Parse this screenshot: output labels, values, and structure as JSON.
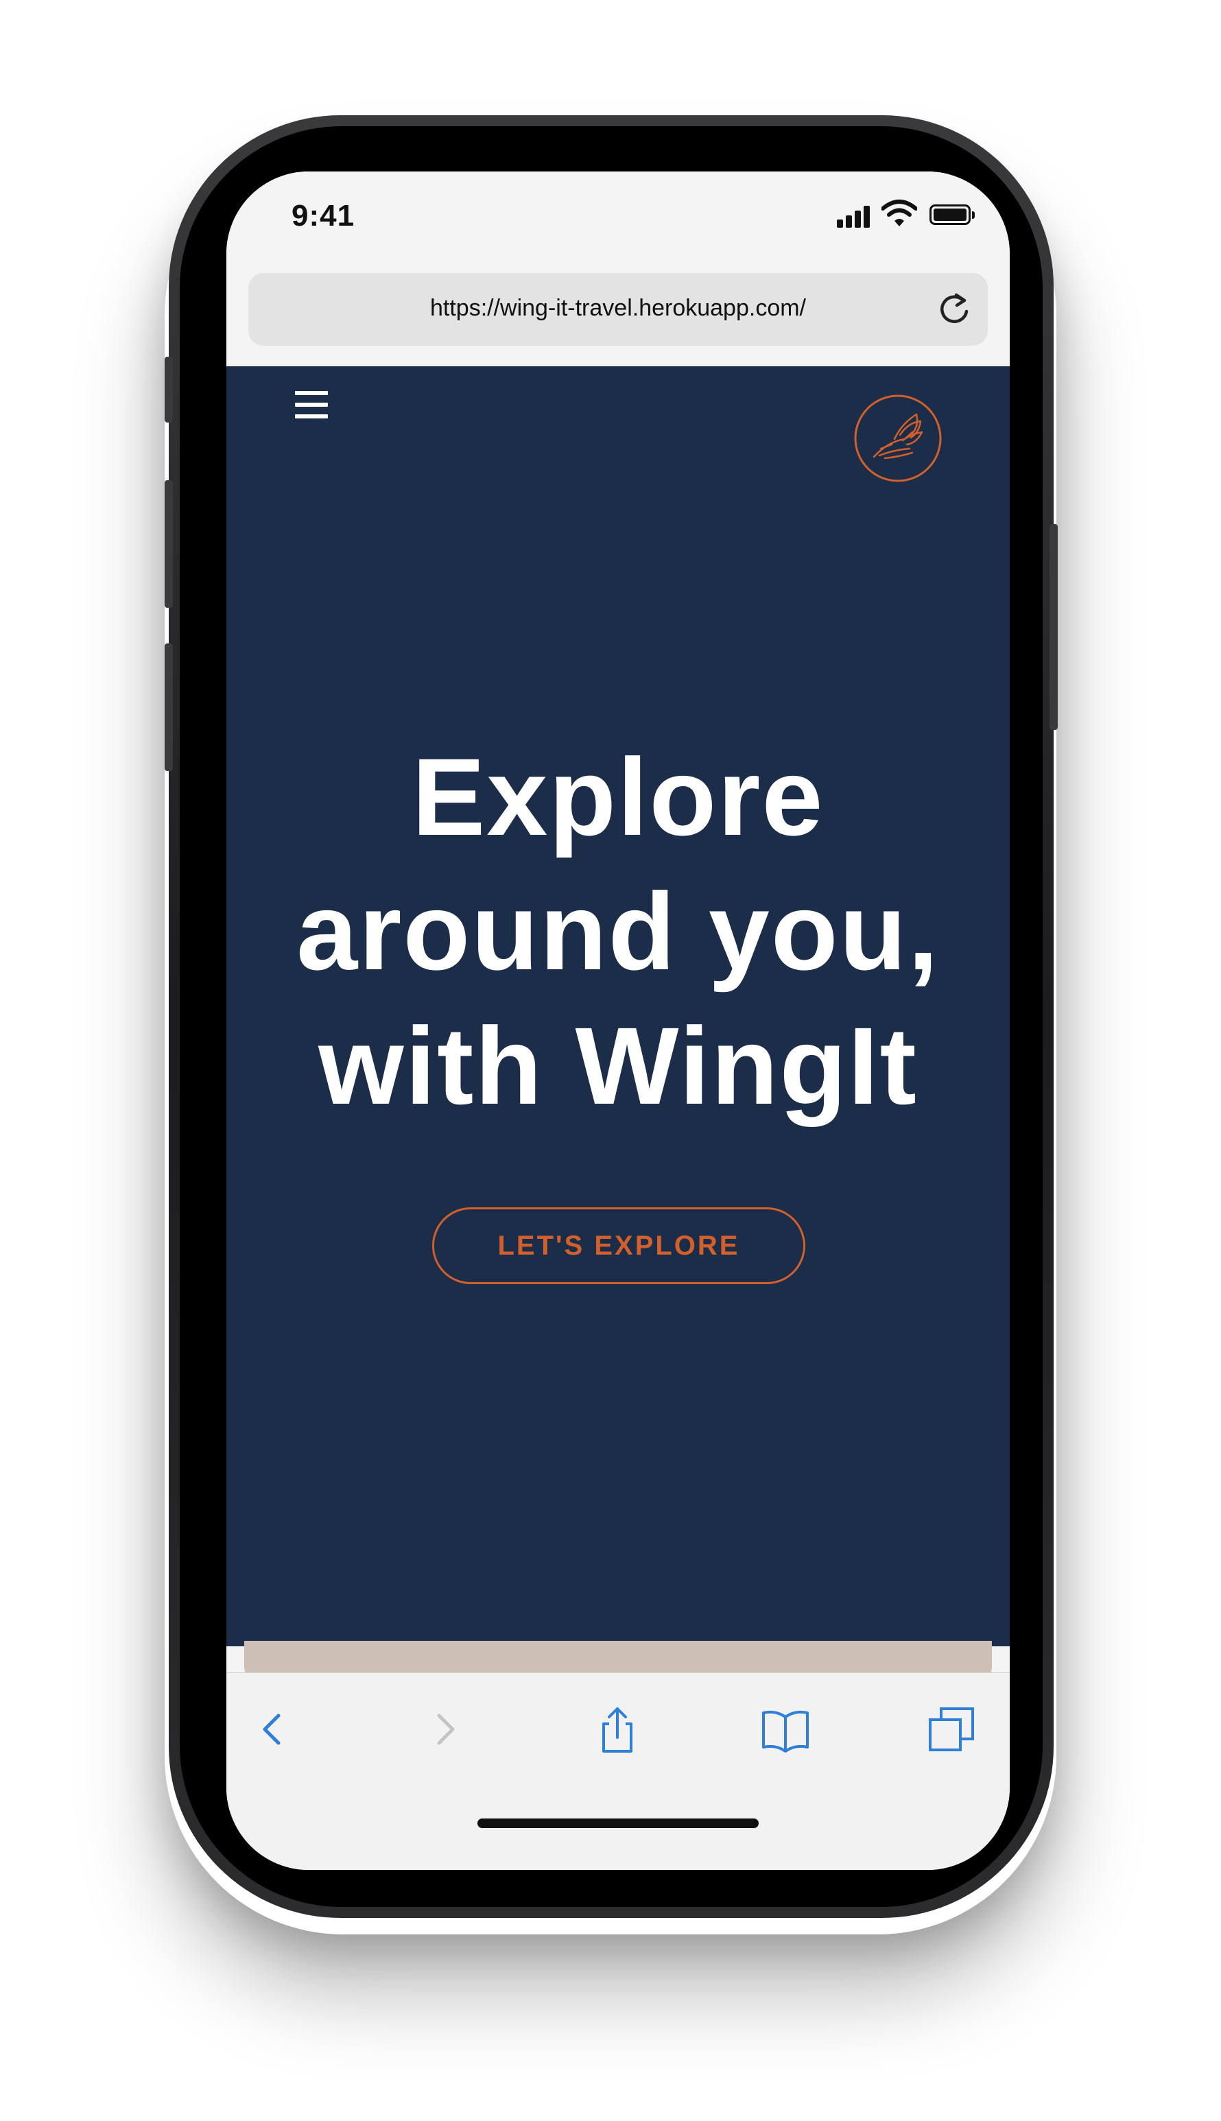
{
  "status_bar": {
    "time": "9:41",
    "icons": [
      "cellular-signal-icon",
      "wifi-icon",
      "battery-icon"
    ]
  },
  "browser": {
    "url": "https://wing-it-travel.herokuapp.com/",
    "reload_icon": "reload-icon",
    "toolbar_icons": [
      "back-icon",
      "forward-icon",
      "share-icon",
      "bookmarks-icon",
      "tabs-icon"
    ]
  },
  "site": {
    "menu_icon": "hamburger-menu-icon",
    "logo_icon": "wings-logo-icon",
    "hero": {
      "line1": "Explore",
      "line2": "around you,",
      "line3": "with WingIt"
    },
    "cta_label": "LET'S EXPLORE",
    "illustration": "phone-map-pin-illustration"
  },
  "colors": {
    "site_background": "#1b2d48",
    "accent_orange": "#d2602c",
    "browser_chrome": "#f4f4f4",
    "url_field": "#e3e3e3",
    "ios_blue": "#2f7fd8",
    "next_section": "#cdbfb4"
  }
}
